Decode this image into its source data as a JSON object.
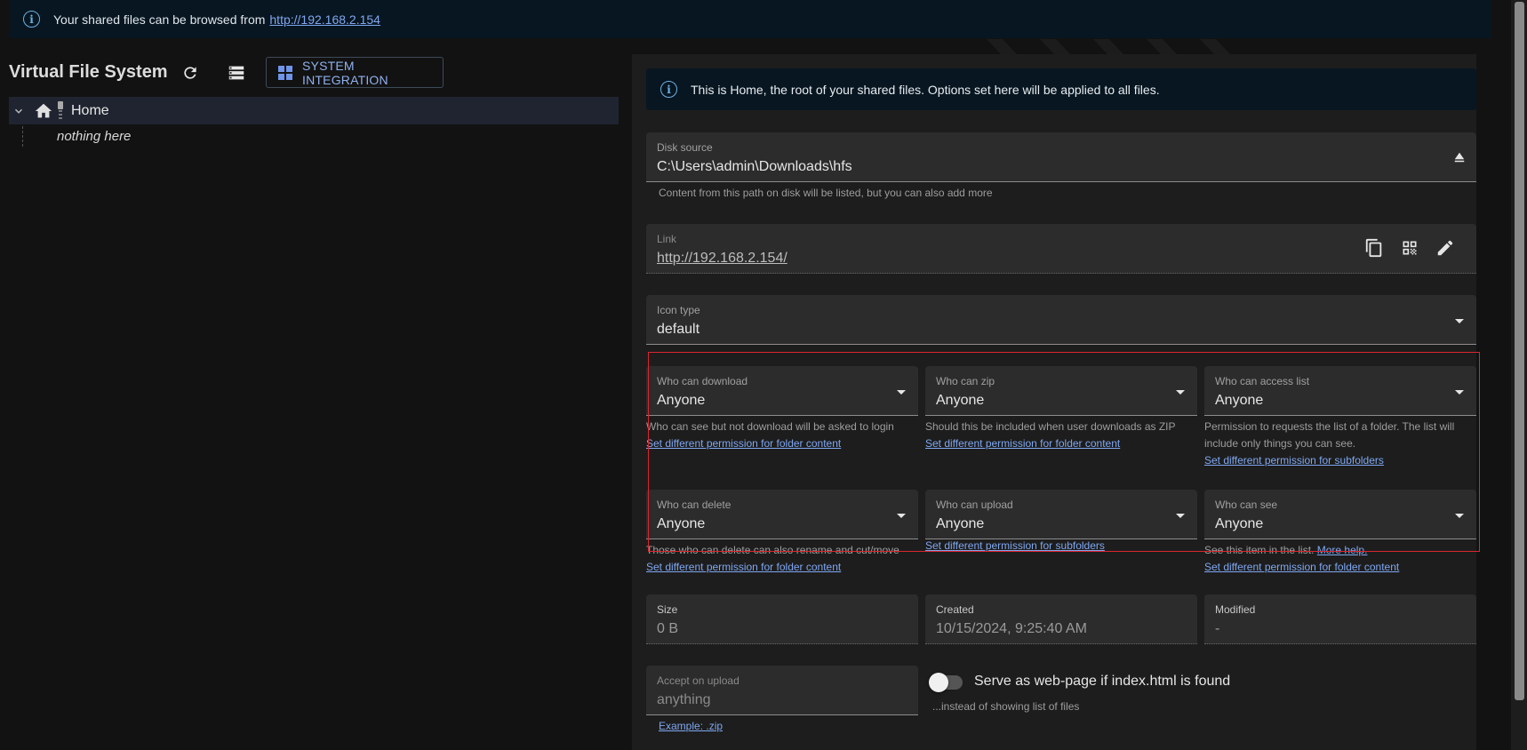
{
  "banner": {
    "text": "Your shared files can be browsed from",
    "link": "http://192.168.2.154"
  },
  "left": {
    "title": "Virtual File System",
    "system_integration_label": "SYSTEM INTEGRATION",
    "tree": {
      "root_label": "Home",
      "empty_text": "nothing here"
    }
  },
  "right": {
    "notice": "This is Home, the root of your shared files. Options set here will be applied to all files.",
    "disk_source": {
      "label": "Disk source",
      "value": "C:\\Users\\admin\\Downloads\\hfs",
      "helper": "Content from this path on disk will be listed, but you can also add more"
    },
    "link": {
      "label": "Link",
      "value": "http://192.168.2.154/"
    },
    "icon_type": {
      "label": "Icon type",
      "value": "default"
    },
    "permissions": {
      "download": {
        "label": "Who can download",
        "value": "Anyone",
        "helper": "Who can see but not download will be asked to login",
        "link": "Set different permission for folder content"
      },
      "zip": {
        "label": "Who can zip",
        "value": "Anyone",
        "helper": "Should this be included when user downloads as ZIP",
        "link": "Set different permission for folder content"
      },
      "access_list": {
        "label": "Who can access list",
        "value": "Anyone",
        "helper": "Permission to requests the list of a folder. The list will include only things you can see.",
        "link": "Set different permission for subfolders"
      },
      "delete": {
        "label": "Who can delete",
        "value": "Anyone",
        "helper": "Those who can delete can also rename and cut/move",
        "link": "Set different permission for folder content"
      },
      "upload": {
        "label": "Who can upload",
        "value": "Anyone",
        "link": "Set different permission for subfolders"
      },
      "see": {
        "label": "Who can see",
        "value": "Anyone",
        "helper": "See this item in the list.",
        "more_help": "More help.",
        "link": "Set different permission for folder content"
      }
    },
    "size": {
      "label": "Size",
      "value": "0 B"
    },
    "created": {
      "label": "Created",
      "value": "10/15/2024, 9:25:40 AM"
    },
    "modified": {
      "label": "Modified",
      "value": "-"
    },
    "accept_upload": {
      "label": "Accept on upload",
      "value": "anything",
      "helper": "Example: .zip"
    },
    "serve_webpage": {
      "label": "Serve as web-page if index.html is found",
      "helper": "...instead of showing list of files",
      "enabled": false
    }
  },
  "icons": {
    "banner": "info-icon",
    "refresh": "refresh-icon",
    "list": "list-icon",
    "windows": "windows-icon",
    "home": "home-icon",
    "eject": "eject-icon",
    "copy": "copy-icon",
    "qr": "qr-code-icon",
    "edit": "pencil-icon"
  },
  "colors": {
    "accent": "#7fa7f0",
    "highlight_box": "#d9252f",
    "info": "#6bb2e4"
  }
}
